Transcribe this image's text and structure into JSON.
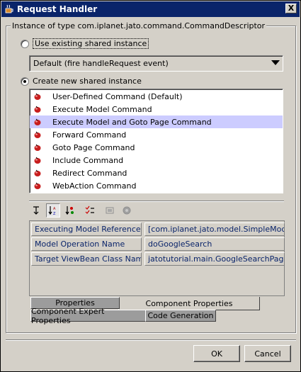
{
  "window": {
    "title": "Request Handler",
    "close_label": "X"
  },
  "group": {
    "legend": "Instance of type com.iplanet.jato.command.CommandDescriptor"
  },
  "use_existing": {
    "label": "Use existing shared instance",
    "checked": false
  },
  "existing_combo": {
    "value": "Default (fire handleRequest event)"
  },
  "create_new": {
    "label": "Create new shared instance",
    "checked": true
  },
  "commands": {
    "items": [
      {
        "label": "User-Defined Command (Default)",
        "selected": false
      },
      {
        "label": "Execute Model Command",
        "selected": false
      },
      {
        "label": "Execute Model and Goto Page Command",
        "selected": true
      },
      {
        "label": "Forward Command",
        "selected": false
      },
      {
        "label": "Goto Page Command",
        "selected": false
      },
      {
        "label": "Include Command",
        "selected": false
      },
      {
        "label": "Redirect Command",
        "selected": false
      },
      {
        "label": "WebAction Command",
        "selected": false
      }
    ],
    "icon": "bean-icon"
  },
  "toolbar": {
    "tools": [
      {
        "name": "unsorted-icon",
        "pressed": false
      },
      {
        "name": "sort-by-name-icon",
        "pressed": true
      },
      {
        "name": "sort-by-type-icon",
        "pressed": false
      },
      {
        "name": "property-list-icon",
        "pressed": false
      },
      {
        "name": "customizer-icon",
        "pressed": false
      },
      {
        "name": "help-icon",
        "pressed": false
      }
    ]
  },
  "properties": {
    "rows": [
      {
        "name": "Executing Model Reference",
        "value": "[com.iplanet.jato.model.SimpleModelReference]"
      },
      {
        "name": "Model Operation Name",
        "value": "doGoogleSearch"
      },
      {
        "name": "Target ViewBean Class Name",
        "value": "jatotutorial.main.GoogleSearchPage"
      }
    ]
  },
  "tabs": {
    "properties": "Properties",
    "component_properties": "Component Properties",
    "component_expert": "Component Expert Properties",
    "code_generation": "Code Generation"
  },
  "buttons": {
    "ok": "OK",
    "cancel": "Cancel"
  },
  "colors": {
    "titlebar": "#0a246a",
    "selection": "#ccccff",
    "property_text": "#0a246a"
  }
}
